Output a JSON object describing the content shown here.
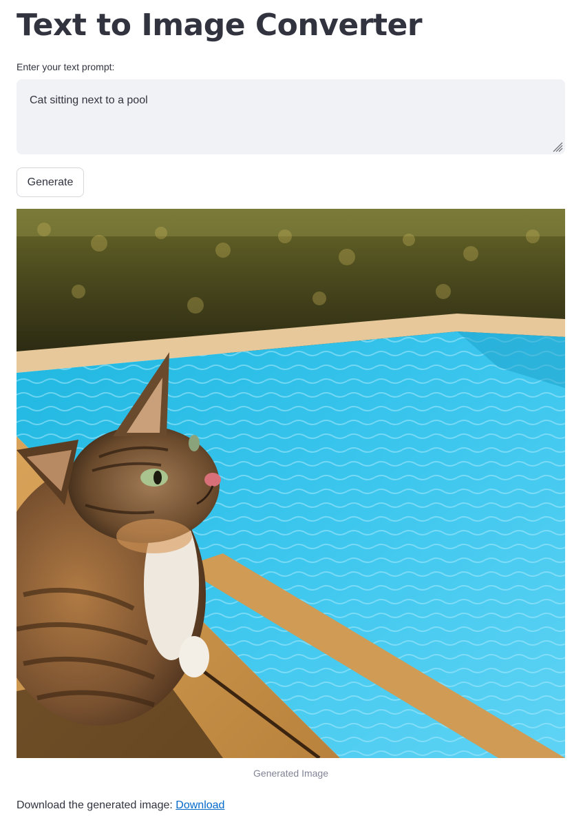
{
  "page": {
    "title": "Text to Image Converter"
  },
  "prompt": {
    "label": "Enter your text prompt:",
    "value": "Cat sitting next to a pool"
  },
  "generate_button": {
    "label": "Generate"
  },
  "result": {
    "caption": "Generated Image"
  },
  "download": {
    "text": "Download the generated image:",
    "link_label": "Download"
  },
  "colors": {
    "text": "#31333f",
    "textarea_bg": "#f0f2f6",
    "caption": "#808495",
    "link": "#0068c9"
  }
}
